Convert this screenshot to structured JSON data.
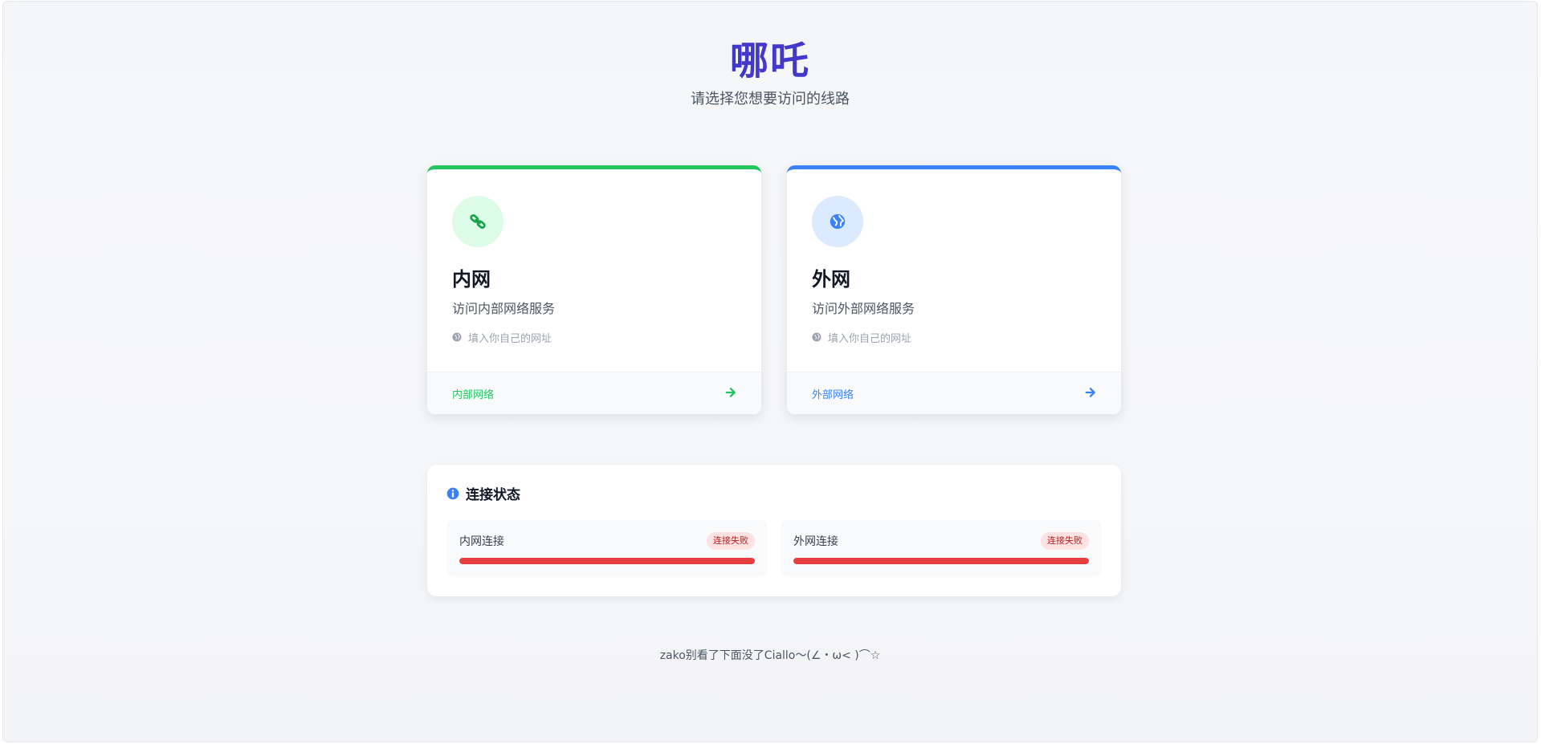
{
  "header": {
    "title": "哪吒",
    "subtitle": "请选择您想要访问的线路"
  },
  "routes": [
    {
      "id": "internal",
      "icon": "link-icon",
      "title": "内网",
      "description": "访问内部网络服务",
      "url_hint": "填入你自己的网址",
      "footer_label": "内部网络",
      "accent": "#22c55e"
    },
    {
      "id": "external",
      "icon": "globe-icon",
      "title": "外网",
      "description": "访问外部网络服务",
      "url_hint": "填入你自己的网址",
      "footer_label": "外部网络",
      "accent": "#3b82f6"
    }
  ],
  "status": {
    "title": "连接状态",
    "items": [
      {
        "label": "内网连接",
        "badge": "连接失败",
        "progress": 1.0,
        "color": "#e53e3e"
      },
      {
        "label": "外网连接",
        "badge": "连接失败",
        "progress": 1.0,
        "color": "#e53e3e"
      }
    ]
  },
  "footer": {
    "text": "zako别看了下面没了Ciallo～(∠・ω< )⌒☆"
  },
  "colors": {
    "title": "#4338ca",
    "failure_badge_bg": "#fee2e2",
    "failure_badge_text": "#b91c1c"
  }
}
